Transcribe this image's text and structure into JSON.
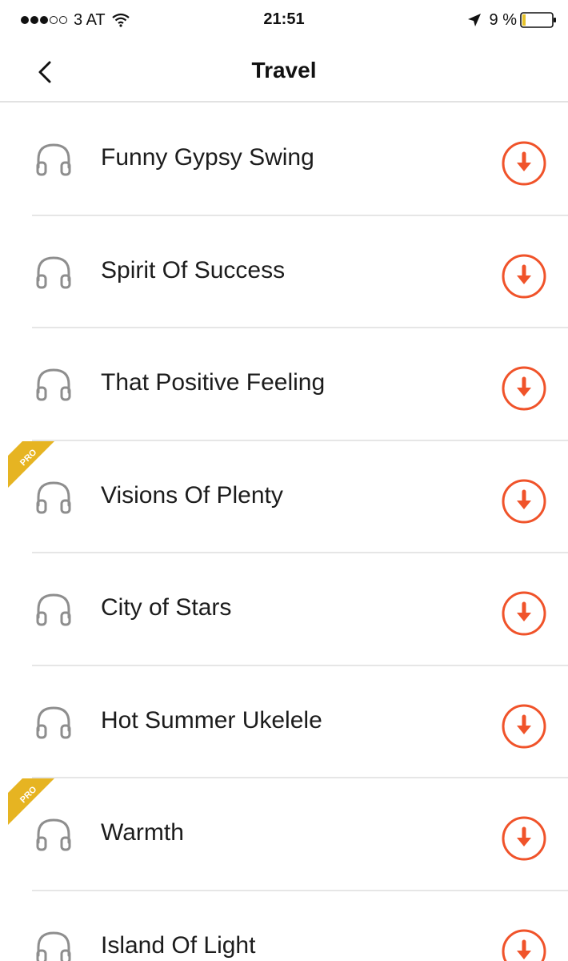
{
  "status_bar": {
    "carrier": "3 AT",
    "time": "21:51",
    "battery": "9 %",
    "signal_icon": "signal-dots-icon",
    "wifi_icon": "wifi-icon",
    "location_icon": "location-arrow-icon",
    "battery_icon": "battery-icon"
  },
  "nav": {
    "back_icon": "chevron-left-icon",
    "title": "Travel"
  },
  "tracks": [
    {
      "title": "Funny Gypsy Swing",
      "pro": false
    },
    {
      "title": "Spirit Of Success",
      "pro": false
    },
    {
      "title": "That Positive Feeling",
      "pro": false
    },
    {
      "title": "Visions Of Plenty",
      "pro": true
    },
    {
      "title": "City of Stars",
      "pro": false
    },
    {
      "title": "Hot Summer Ukelele",
      "pro": false
    },
    {
      "title": "Warmth",
      "pro": true
    },
    {
      "title": "Island Of Light",
      "pro": false
    }
  ],
  "pro_label": "PRO",
  "colors": {
    "accent": "#f0532a",
    "pro_badge": "#e6b422",
    "icon_gray": "#8e8e8e",
    "divider": "#e6e6e6"
  }
}
